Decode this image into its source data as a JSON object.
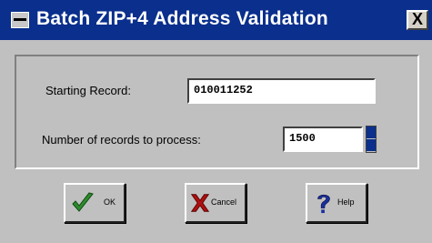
{
  "window": {
    "title": "Batch ZIP+4 Address Validation",
    "close_glyph": "X"
  },
  "form": {
    "starting_record_label": "Starting Record:",
    "starting_record_value": "010011252",
    "num_records_label": "Number of records to process:",
    "num_records_value": "1500"
  },
  "buttons": {
    "ok_label": "OK",
    "cancel_label": "Cancel",
    "help_label": "Help"
  },
  "icons": {
    "ok": "checkmark-icon",
    "cancel": "x-mark-icon",
    "help": "question-mark-icon"
  },
  "colors": {
    "titlebar": "#0a2f8c",
    "window_bg": "#c0c0c0",
    "ok_check": "#2e8b2e",
    "cancel_x": "#b01010",
    "help_q": "#1a2fa0"
  }
}
